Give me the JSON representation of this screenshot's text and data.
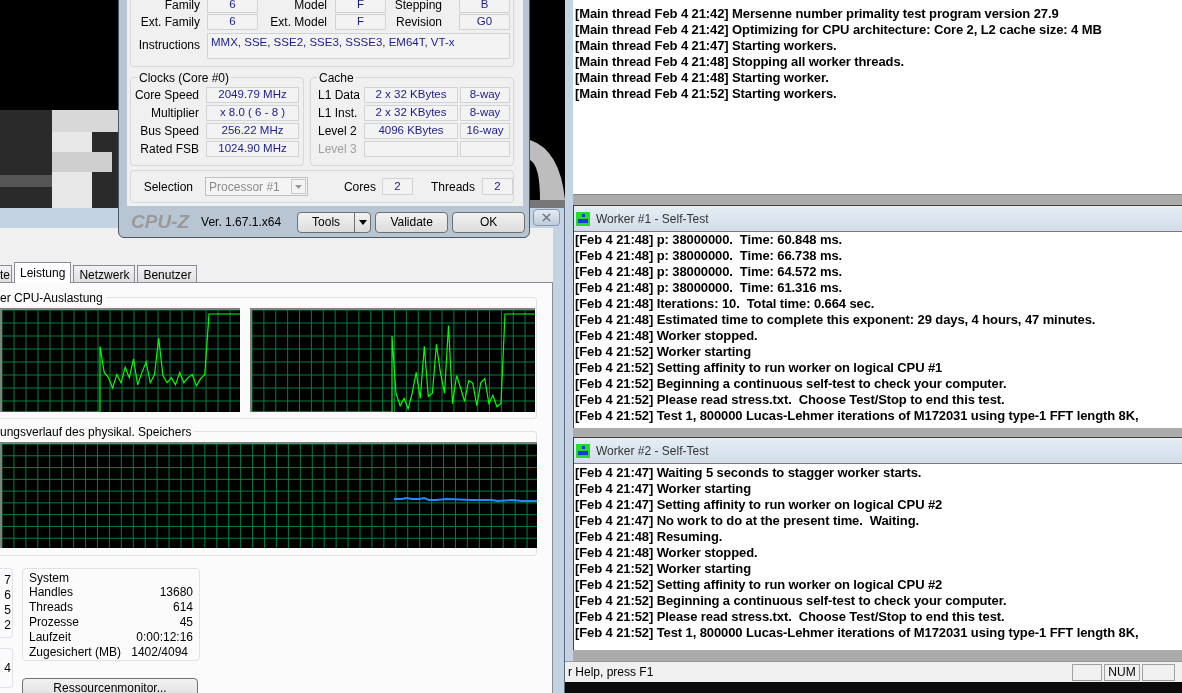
{
  "cpuz": {
    "processor_rows": [
      [
        {
          "label": "Family",
          "value": "6"
        },
        {
          "label": "Model",
          "value": "F"
        },
        {
          "label": "Stepping",
          "value": "B"
        }
      ],
      [
        {
          "label": "Ext. Family",
          "value": "6"
        },
        {
          "label": "Ext. Model",
          "value": "F"
        },
        {
          "label": "Revision",
          "value": "G0"
        }
      ]
    ],
    "instructions": {
      "label": "Instructions",
      "value": "MMX, SSE, SSE2, SSE3, SSSE3, EM64T, VT-x"
    },
    "clocks": {
      "title": "Clocks (Core #0)",
      "rows": [
        {
          "label": "Core Speed",
          "value": "2049.79 MHz"
        },
        {
          "label": "Multiplier",
          "value": "x 8.0 ( 6 - 8 )"
        },
        {
          "label": "Bus Speed",
          "value": "256.22 MHz"
        },
        {
          "label": "Rated FSB",
          "value": "1024.90 MHz"
        }
      ]
    },
    "cache": {
      "title": "Cache",
      "rows": [
        {
          "label": "L1 Data",
          "size": "2 x 32 KBytes",
          "ways": "8-way",
          "disabled": false
        },
        {
          "label": "L1 Inst.",
          "size": "2 x 32 KBytes",
          "ways": "8-way",
          "disabled": false
        },
        {
          "label": "Level 2",
          "size": "4096 KBytes",
          "ways": "16-way",
          "disabled": false
        },
        {
          "label": "Level 3",
          "disabled": true
        }
      ]
    },
    "selection": {
      "label": "Selection",
      "value": "Processor #1",
      "disabled": true
    },
    "cores": {
      "label": "Cores",
      "value": "2"
    },
    "threads": {
      "label": "Threads",
      "value": "2"
    },
    "brand": "CPU-Z",
    "version": "Ver. 1.67.1.x64",
    "buttons": [
      {
        "label": "Tools",
        "kind": "dropdown"
      },
      {
        "label": "Validate",
        "kind": "plain"
      },
      {
        "label": "OK",
        "kind": "plain"
      }
    ]
  },
  "task_manager": {
    "tabs": [
      {
        "label": "te",
        "selected": false
      },
      {
        "label": "Leistung",
        "selected": true
      },
      {
        "label": "Netzwerk",
        "selected": false
      },
      {
        "label": "Benutzer",
        "selected": false
      }
    ],
    "cpu_group": "er CPU-Auslastung",
    "memory_group": "ungsverlauf des physikal. Speichers",
    "partial_values": [
      "7",
      "6",
      "5",
      "2"
    ],
    "partial_values_2": [
      "4"
    ],
    "system": {
      "title": "System",
      "rows": [
        {
          "label": "Handles",
          "value": "13680"
        },
        {
          "label": "Threads",
          "value": "614"
        },
        {
          "label": "Prozesse",
          "value": "45"
        },
        {
          "label": "Laufzeit",
          "value": "0:00:12:16"
        },
        {
          "label": "Zugesichert (MB)",
          "value": "1402/4094"
        }
      ]
    },
    "button": "Ressourcenmonitor..."
  },
  "prime95": {
    "messages": [
      "[Main thread Feb 4 21:42] Mersenne number primality test program version 27.9",
      "[Main thread Feb 4 21:42] Optimizing for CPU architecture: Core 2, L2 cache size: 4 MB",
      "[Main thread Feb 4 21:47] Starting workers.",
      "[Main thread Feb 4 21:48] Stopping all worker threads.",
      "[Main thread Feb 4 21:48] Starting worker.",
      "[Main thread Feb 4 21:52] Starting workers."
    ],
    "workers": [
      {
        "title": "Worker #1 - Self-Test",
        "lines": [
          "[Feb 4 21:48] p: 38000000.  Time: 60.848 ms.",
          "[Feb 4 21:48] p: 38000000.  Time: 66.738 ms.",
          "[Feb 4 21:48] p: 38000000.  Time: 64.572 ms.",
          "[Feb 4 21:48] p: 38000000.  Time: 61.316 ms.",
          "[Feb 4 21:48] Iterations: 10.  Total time: 0.664 sec.",
          "[Feb 4 21:48] Estimated time to complete this exponent: 29 days, 4 hours, 47 minutes.",
          "[Feb 4 21:48] Worker stopped.",
          "[Feb 4 21:52] Worker starting",
          "[Feb 4 21:52] Setting affinity to run worker on logical CPU #1",
          "[Feb 4 21:52] Beginning a continuous self-test to check your computer.",
          "[Feb 4 21:52] Please read stress.txt.  Choose Test/Stop to end this test.",
          "[Feb 4 21:52] Test 1, 800000 Lucas-Lehmer iterations of M172031 using type-1 FFT length 8K,"
        ]
      },
      {
        "title": "Worker #2 - Self-Test",
        "lines": [
          "[Feb 4 21:47] Waiting 5 seconds to stagger worker starts.",
          "[Feb 4 21:47] Worker starting",
          "[Feb 4 21:47] Setting affinity to run worker on logical CPU #2",
          "[Feb 4 21:47] No work to do at the present time.  Waiting.",
          "[Feb 4 21:48] Resuming.",
          "[Feb 4 21:48] Worker stopped.",
          "[Feb 4 21:52] Worker starting",
          "[Feb 4 21:52] Setting affinity to run worker on logical CPU #2",
          "[Feb 4 21:52] Beginning a continuous self-test to check your computer.",
          "[Feb 4 21:52] Please read stress.txt.  Choose Test/Stop to end this test.",
          "[Feb 4 21:52] Test 1, 800000 Lucas-Lehmer iterations of M172031 using type-1 FFT length 8K,"
        ]
      }
    ],
    "status_bar": {
      "text": "r Help, press F1",
      "indicator": "NUM"
    }
  }
}
